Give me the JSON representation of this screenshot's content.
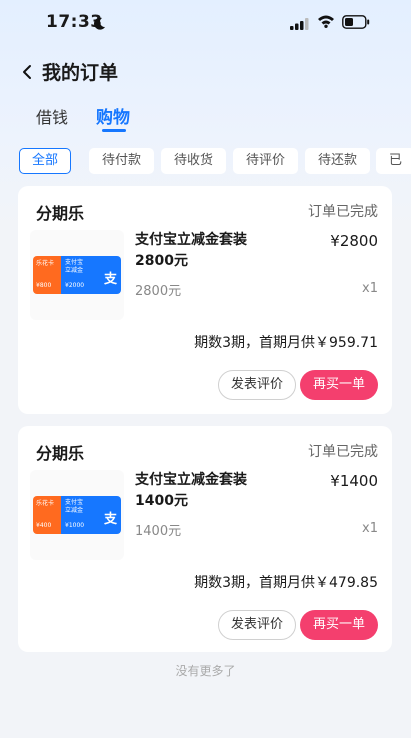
{
  "status_bar": {
    "time": "17:33"
  },
  "nav": {
    "title": "我的订单"
  },
  "tabs": [
    {
      "label": "借钱"
    },
    {
      "label": "购物"
    }
  ],
  "filters": [
    {
      "label": "全部"
    },
    {
      "label": "待付款"
    },
    {
      "label": "待收货"
    },
    {
      "label": "待评价"
    },
    {
      "label": "待还款"
    },
    {
      "label": "已"
    }
  ],
  "orders": [
    {
      "merchant": "分期乐",
      "status": "订单已完成",
      "product_name": "支付宝立减金套装2800元",
      "price": "¥2800",
      "spec": "2800元",
      "qty": "x1",
      "installment": "期数3期，首期月供￥959.71",
      "thumb": {
        "brand_left": "乐花卡",
        "brand_right": "支付宝",
        "sub_right": "立减金",
        "amount_left": "¥800",
        "amount_right": "¥2000",
        "logo": "支"
      },
      "review_label": "发表评价",
      "rebuy_label": "再买一单"
    },
    {
      "merchant": "分期乐",
      "status": "订单已完成",
      "product_name": "支付宝立减金套装1400元",
      "price": "¥1400",
      "spec": "1400元",
      "qty": "x1",
      "installment": "期数3期，首期月供￥479.85",
      "thumb": {
        "brand_left": "乐花卡",
        "brand_right": "支付宝",
        "sub_right": "立减金",
        "amount_left": "¥400",
        "amount_right": "¥1000",
        "logo": "支"
      },
      "review_label": "发表评价",
      "rebuy_label": "再买一单"
    }
  ],
  "footer": {
    "no_more": "没有更多了"
  },
  "colors": {
    "accent": "#1677ff",
    "rebuy": "#f43f6e",
    "thumb_orange": "#ff6a1f"
  },
  "icons": {
    "back": "chevron-left-icon",
    "moon": "moon-icon",
    "signal": "signal-icon",
    "wifi": "wifi-icon",
    "battery": "battery-icon"
  }
}
